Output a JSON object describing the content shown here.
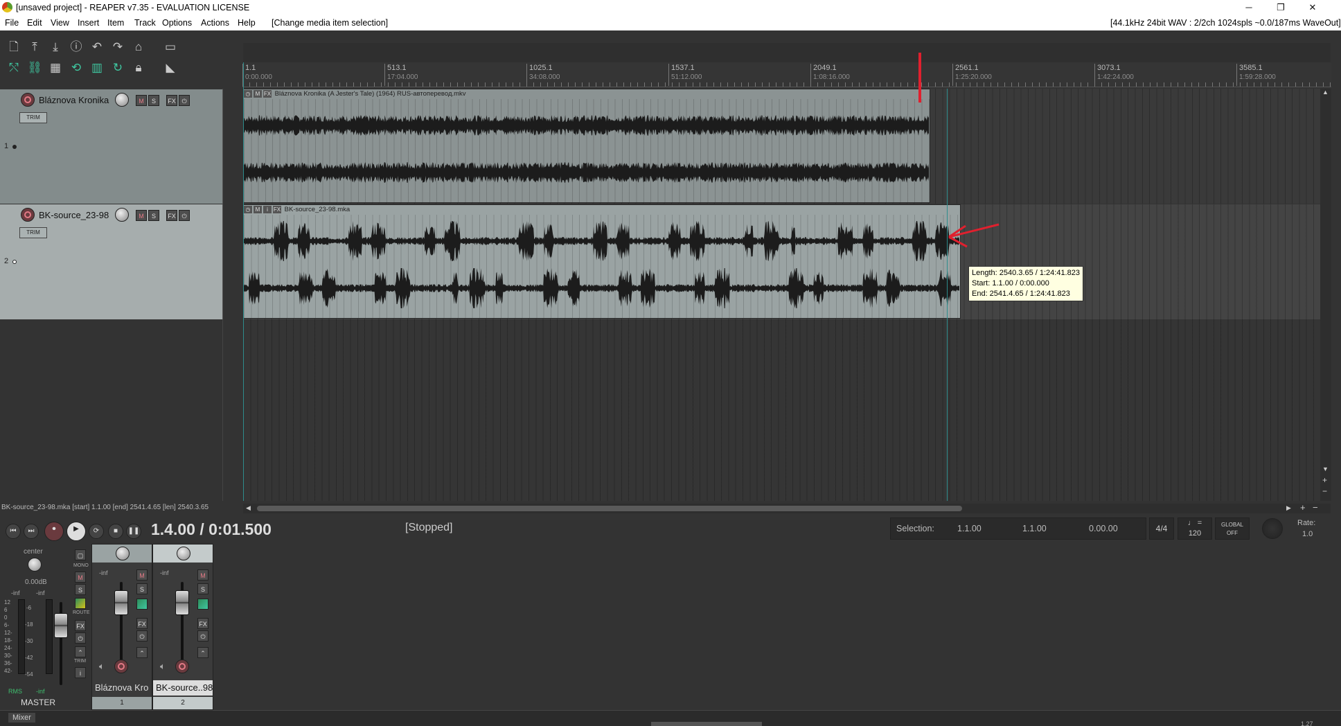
{
  "titlebar": {
    "title": "[unsaved project] - REAPER v7.35 - EVALUATION LICENSE",
    "minimize": "─",
    "maximize": "❐",
    "close": "✕"
  },
  "menu": {
    "items": [
      "File",
      "Edit",
      "View",
      "Insert",
      "Item",
      "Track",
      "Options",
      "Actions",
      "Help",
      "[Change media item selection]"
    ],
    "audio_status": "[44.1kHz 24bit WAV : 2/2ch 1024spls ~0.0/187ms WaveOut]"
  },
  "ruler": {
    "markers": [
      {
        "bar": "1.1",
        "time": "0:00.000"
      },
      {
        "bar": "513.1",
        "time": "17:04.000"
      },
      {
        "bar": "1025.1",
        "time": "34:08.000"
      },
      {
        "bar": "1537.1",
        "time": "51:12.000"
      },
      {
        "bar": "2049.1",
        "time": "1:08:16.000"
      },
      {
        "bar": "2561.1",
        "time": "1:25:20.000"
      },
      {
        "bar": "3073.1",
        "time": "1:42:24.000"
      },
      {
        "bar": "3585.1",
        "time": "1:59:28.000"
      }
    ]
  },
  "tracks": [
    {
      "number": "1",
      "name": "Bláznova Kronika",
      "mute": "M",
      "solo": "S",
      "fx": "FX",
      "trim": "TRIM",
      "item": {
        "name": "Bláznova Kronika  (A Jester's Tale) (1964) RUS-автоперевод.mkv",
        "length_fraction": 0.632
      }
    },
    {
      "number": "2",
      "name": "BK-source_23-98",
      "mute": "M",
      "solo": "S",
      "fx": "FX",
      "trim": "TRIM",
      "item": {
        "name": "BK-source_23-98.mka",
        "length_fraction": 0.66
      }
    }
  ],
  "tooltip": {
    "length": "Length: 2540.3.65 / 1:24:41.823",
    "start": "Start: 1.1.00 / 0:00.000",
    "end": "End: 2541.4.65 / 1:24:41.823"
  },
  "statusline": "BK-source_23-98.mka [start] 1.1.00 [end] 2541.4.65 [len] 2540.3.65",
  "transport": {
    "position": "1.4.00 / 0:01.500",
    "state": "[Stopped]",
    "selection_label": "Selection:",
    "sel_start": "1.1.00",
    "sel_end": "1.1.00",
    "sel_len": "0.00.00",
    "timesig": "4/4",
    "tempo": "120",
    "tempo_icon": "♩ =",
    "global_label": "GLOBAL",
    "global_state": "OFF",
    "rate_label": "Rate:",
    "rate_value": "1.0"
  },
  "mixer": {
    "master": {
      "pan": "center",
      "volume": "0.00dB",
      "peak_l": "-inf",
      "peak_r": "-inf",
      "rms_label": "RMS",
      "rms_value": "-inf",
      "label": "MASTER",
      "mono": "MONO",
      "route": "ROUTE",
      "trim": "TRIM",
      "scale": [
        "12",
        "6",
        "0",
        "6-",
        "12-",
        "18-",
        "24-",
        "30-",
        "36-",
        "42-"
      ],
      "scale_mid": [
        "-6",
        "-18",
        "-30",
        "-42",
        "-54"
      ],
      "scale_right": [
        "12",
        "6",
        "0",
        "-6",
        "-12",
        "-18",
        "-24",
        "-30",
        "-36",
        "-42"
      ]
    },
    "strips": [
      {
        "label": "Bláznova Kro",
        "number": "1",
        "peak": "-inf",
        "mute": "M",
        "solo": "S",
        "fx": "FX"
      },
      {
        "label": "BK-source..98",
        "number": "2",
        "peak": "-inf",
        "mute": "M",
        "solo": "S",
        "fx": "FX"
      }
    ]
  },
  "bottom": {
    "mixer_tab": "Mixer",
    "right_text": "1.27"
  },
  "colors": {
    "background": "#333333",
    "item": "#8b9393",
    "playhead_red": "#e0202e",
    "cursor": "#2e8c8c"
  }
}
